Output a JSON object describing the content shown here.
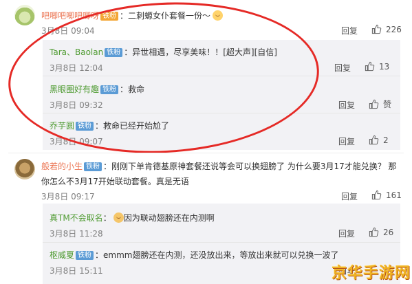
{
  "comments": [
    {
      "username": "吧唧吧唧吧唧呀",
      "badge": "铁粉",
      "text": "：二刺螈女仆套餐一份～",
      "time": "3月8日 09:04",
      "reply_label": "回复",
      "likes": "226"
    },
    {
      "username": "般若的小生",
      "badge": "铁粉",
      "text_line1": "：刚刚下单肯德基原神套餐还说等会可以换翅膀了  为什么要3月17才能兑换？  那",
      "text_line2": "你怎么不3月17开始联动套餐。真是无语",
      "time": "3月8日 09:17",
      "reply_label": "回复",
      "likes": "161"
    }
  ],
  "replies_group_1": [
    {
      "username": "Tara、Baolan",
      "badge": "铁粉",
      "text": "：异世相遇，尽享美味！！[超大声][自信]",
      "time": "3月8日 12:04",
      "reply_label": "回复",
      "likes": "13"
    },
    {
      "username": "黑眼圈好有趣",
      "badge": "铁粉",
      "text": "：救命",
      "time": "3月8日 09:32",
      "reply_label": "回复",
      "likes": "赞"
    },
    {
      "username": "乔芋圆",
      "badge": "铁粉",
      "text": "：救命已经开始尬了",
      "time": "3月8日 09:07",
      "reply_label": "回复",
      "likes": "2"
    }
  ],
  "replies_group_2": [
    {
      "username": "真TM不会取名",
      "text": "：",
      "text_after": "因为联动翅膀还在内测啊",
      "time": "3月8日 11:28",
      "reply_label": "回复",
      "likes": "26"
    },
    {
      "username": "枢威夏",
      "badge": "铁粉",
      "text": "：emmm翅膀还在内测，还没放出来，等放出来就可以兑换一波了",
      "time": "3月8日 15:11",
      "reply_label": "回复"
    }
  ],
  "watermark": "京华手游网",
  "colors": {
    "annotation_ring": "#e52a26",
    "badge": "#5b9bd5",
    "username": "#eb7350"
  }
}
